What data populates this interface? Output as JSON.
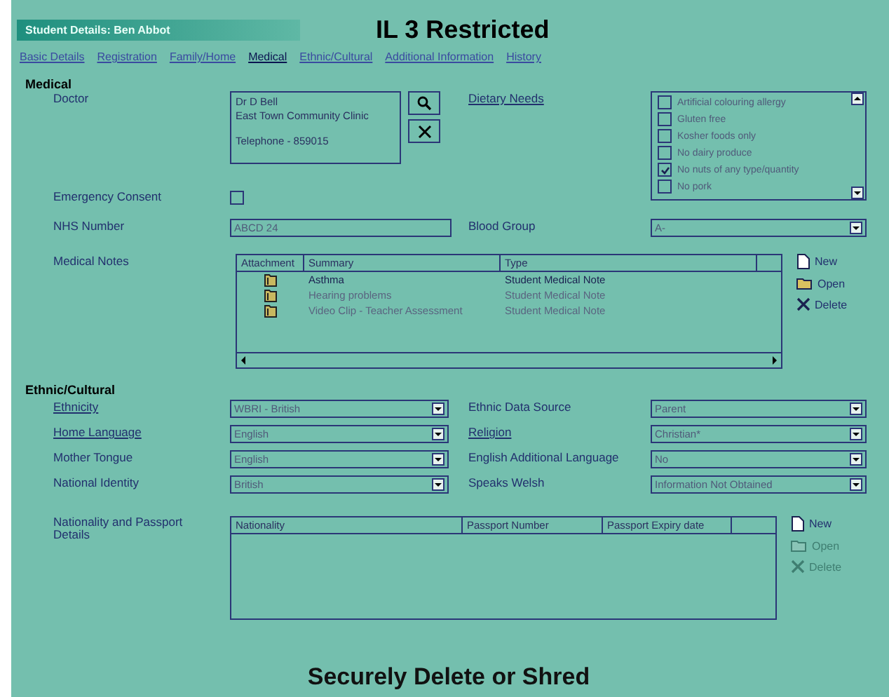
{
  "header": {
    "window_title": "Student Details: Ben Abbot",
    "classification": "IL 3 Restricted"
  },
  "tabs": [
    {
      "label": "Basic Details",
      "selected": false
    },
    {
      "label": "Registration",
      "selected": false
    },
    {
      "label": "Family/Home",
      "selected": false
    },
    {
      "label": "Medical",
      "selected": true
    },
    {
      "label": "Ethnic/Cultural",
      "selected": false
    },
    {
      "label": "Additional Information",
      "selected": false
    },
    {
      "label": "History",
      "selected": false
    }
  ],
  "medical": {
    "heading": "Medical",
    "doctor_label": "Doctor",
    "doctor_lines": [
      "Dr D Bell",
      "East Town Community Clinic"
    ],
    "doctor_telephone": "Telephone - 859015",
    "dietary_label": "Dietary Needs",
    "dietary_items": [
      {
        "label": "Artificial colouring allergy",
        "checked": false
      },
      {
        "label": "Gluten free",
        "checked": false
      },
      {
        "label": "Kosher foods only",
        "checked": false
      },
      {
        "label": "No dairy produce",
        "checked": false
      },
      {
        "label": "No nuts of any type/quantity",
        "checked": true
      },
      {
        "label": "No pork",
        "checked": false
      }
    ],
    "emergency_label": "Emergency Consent",
    "emergency_checked": false,
    "nhs_label": "NHS Number",
    "nhs_value": "ABCD 24",
    "blood_label": "Blood Group",
    "blood_value": "A-",
    "notes_label": "Medical Notes",
    "notes_columns": [
      "Attachment",
      "Summary",
      "Type"
    ],
    "notes_rows": [
      {
        "summary": "Asthma",
        "type": "Student Medical Note",
        "selected": true
      },
      {
        "summary": "Hearing problems",
        "type": "Student Medical Note",
        "selected": false
      },
      {
        "summary": "Video Clip - Teacher Assessment",
        "type": "Student Medical Note",
        "selected": false
      }
    ],
    "notes_actions": [
      {
        "kind": "new",
        "label": "New",
        "disabled": false
      },
      {
        "kind": "open",
        "label": "Open",
        "disabled": false
      },
      {
        "kind": "delete",
        "label": "Delete",
        "disabled": false
      }
    ]
  },
  "ethnic": {
    "heading": "Ethnic/Cultural",
    "fields": [
      {
        "label": "Ethnicity",
        "link": true,
        "value": "WBRI - British"
      },
      {
        "label": "Ethnic Data Source",
        "link": false,
        "value": "Parent"
      },
      {
        "label": "Home Language",
        "link": true,
        "value": "English"
      },
      {
        "label": "Religion",
        "link": true,
        "value": "Christian*"
      },
      {
        "label": "Mother Tongue",
        "link": false,
        "value": "English"
      },
      {
        "label": "English Additional Language",
        "link": false,
        "value": "No"
      },
      {
        "label": "National Identity",
        "link": false,
        "value": "British"
      },
      {
        "label": "Speaks Welsh",
        "link": false,
        "value": "Information Not Obtained"
      }
    ],
    "passport_label": "Nationality and Passport Details",
    "passport_columns": [
      "Nationality",
      "Passport Number",
      "Passport Expiry date"
    ],
    "passport_actions": [
      {
        "kind": "new",
        "label": "New",
        "disabled": false
      },
      {
        "kind": "open",
        "label": "Open",
        "disabled": true
      },
      {
        "kind": "delete",
        "label": "Delete",
        "disabled": true
      }
    ]
  },
  "footer": "Securely Delete or Shred"
}
